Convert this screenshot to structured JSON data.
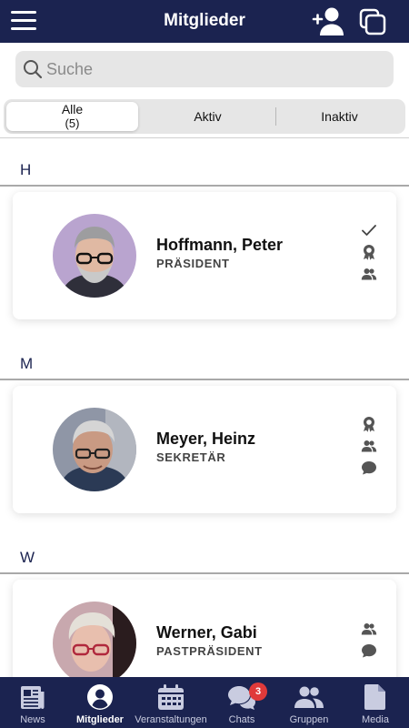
{
  "header": {
    "title": "Mitglieder"
  },
  "search": {
    "placeholder": "Suche"
  },
  "filter": {
    "segments": [
      {
        "label": "Alle",
        "count": "(5)"
      },
      {
        "label": "Aktiv"
      },
      {
        "label": "Inaktiv"
      }
    ],
    "active": "Alle"
  },
  "sections": [
    {
      "letter": "H",
      "members": [
        {
          "name": "Hoffmann, Peter",
          "role": "PRÄSIDENT",
          "icons": [
            "checkmark-icon",
            "award-icon",
            "group-icon"
          ]
        }
      ]
    },
    {
      "letter": "M",
      "members": [
        {
          "name": "Meyer, Heinz",
          "role": "SEKRETÄR",
          "icons": [
            "award-icon",
            "group-icon",
            "chat-icon"
          ]
        }
      ]
    },
    {
      "letter": "W",
      "members": [
        {
          "name": "Werner, Gabi",
          "role": "PASTPRÄSIDENT",
          "icons": [
            "group-icon",
            "chat-icon"
          ]
        }
      ]
    }
  ],
  "tabbar": {
    "items": [
      {
        "label": "News",
        "icon": "news-icon"
      },
      {
        "label": "Mitglieder",
        "icon": "person-icon"
      },
      {
        "label": "Veranstaltungen",
        "icon": "calendar-icon"
      },
      {
        "label": "Chats",
        "icon": "chat-bubbles-icon",
        "badge": "3"
      },
      {
        "label": "Gruppen",
        "icon": "group-icon"
      },
      {
        "label": "Media",
        "icon": "document-icon"
      }
    ],
    "active": "Mitglieder"
  },
  "colors": {
    "primary": "#1b2350",
    "badge": "#e03a3a",
    "background": "#ffffff"
  }
}
